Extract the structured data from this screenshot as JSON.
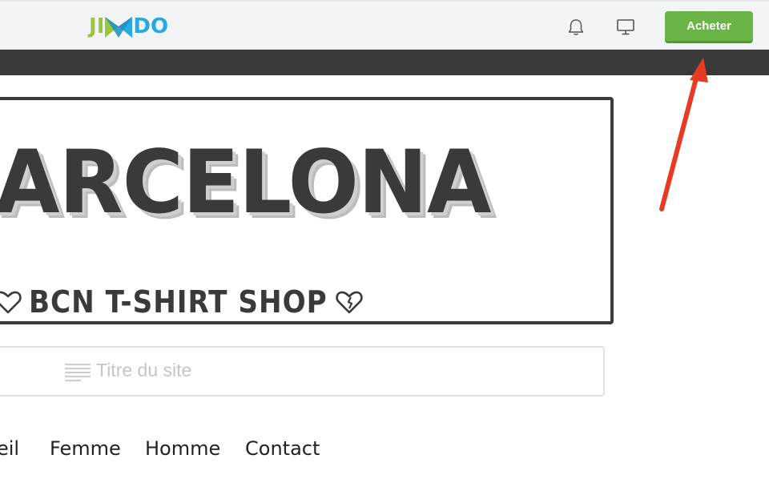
{
  "header": {
    "logo": {
      "letters": [
        "J",
        "I",
        "D",
        "O"
      ],
      "name": "Jimdo",
      "colors": {
        "green": "#9bc53d",
        "blue": "#27a9e1"
      }
    },
    "notification_icon": "bell-icon",
    "preview_icon": "monitor-icon",
    "buy_button_label": "Acheter"
  },
  "banner": {
    "title": "ARCELONA",
    "subtitle": "BCN T-SHIRT SHOP"
  },
  "site_title_field": {
    "placeholder": "Titre du site",
    "icon": "text-lines-icon"
  },
  "nav": {
    "items": [
      "eil",
      "Femme",
      "Homme",
      "Contact"
    ]
  },
  "annotation": {
    "type": "arrow",
    "color": "#e83a24",
    "target": "buy-button"
  },
  "colors": {
    "buy_button": "#6ab445",
    "dark_strip": "#3a3a3a",
    "text_dark": "#3a3a3a"
  }
}
